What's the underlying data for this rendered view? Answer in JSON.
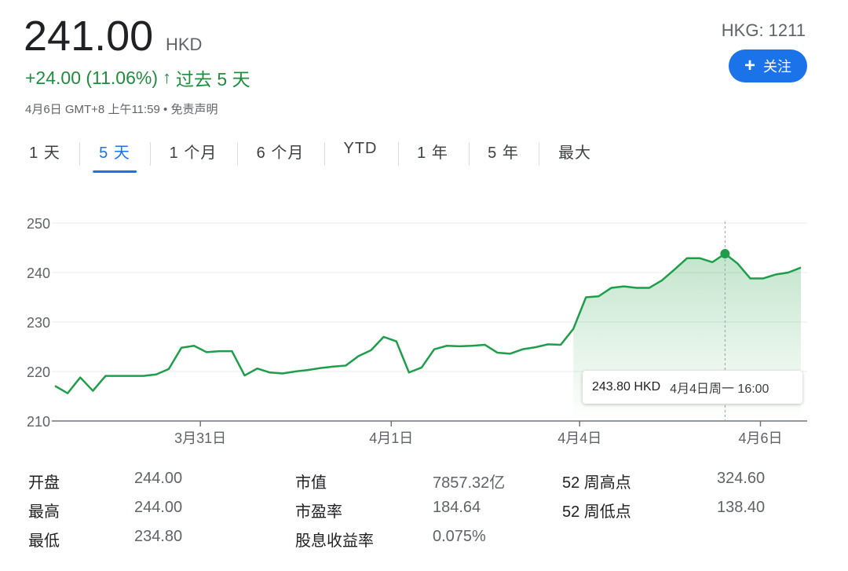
{
  "header": {
    "price": "241.00",
    "currency": "HKD",
    "change": "+24.00 (11.06%)",
    "period": "过去 5 天",
    "timestamp": "4月6日 GMT+8 上午11:59 • 免责声明",
    "ticker": "HKG: 1211",
    "follow_label": "关注"
  },
  "tabs": [
    "1 天",
    "5 天",
    "1 个月",
    "6 个月",
    "YTD",
    "1 年",
    "5 年",
    "最大"
  ],
  "active_tab": "5 天",
  "tooltip": {
    "price": "243.80 HKD",
    "time": "4月4日周一 16:00"
  },
  "stats": {
    "col1": [
      {
        "label": "开盘",
        "value": "244.00"
      },
      {
        "label": "最高",
        "value": "244.00"
      },
      {
        "label": "最低",
        "value": "234.80"
      }
    ],
    "col2": [
      {
        "label": "市值",
        "value": "7857.32亿"
      },
      {
        "label": "市盈率",
        "value": "184.64"
      },
      {
        "label": "股息收益率",
        "value": "0.075%"
      }
    ],
    "col3": [
      {
        "label": "52 周高点",
        "value": "324.60"
      },
      {
        "label": "52 周低点",
        "value": "138.40"
      }
    ]
  },
  "colors": {
    "up": "#1e8e3e",
    "line": "#1e9e4a",
    "accent": "#1a73e8"
  },
  "chart_data": {
    "type": "area",
    "ylim": [
      210,
      250
    ],
    "yticks": [
      210,
      220,
      230,
      240,
      250
    ],
    "xlabels": [
      "3月31日",
      "4月1日",
      "4月4日",
      "4月6日"
    ],
    "xlabel_index": [
      11.5,
      26.6,
      41.5,
      55.8
    ],
    "values": [
      217.1,
      215.6,
      218.8,
      216.1,
      219.1,
      219.1,
      219.1,
      219.1,
      219.4,
      220.5,
      224.8,
      225.2,
      223.9,
      224.1,
      224.1,
      219.2,
      220.6,
      219.8,
      219.6,
      220.0,
      220.3,
      220.7,
      221.0,
      221.2,
      223.1,
      224.3,
      227.0,
      226.1,
      219.8,
      220.8,
      224.5,
      225.2,
      225.1,
      225.2,
      225.4,
      223.8,
      223.6,
      224.5,
      224.9,
      225.5,
      225.4,
      228.6,
      235.0,
      235.2,
      236.9,
      237.2,
      236.9,
      236.9,
      238.4,
      240.6,
      242.9,
      242.9,
      242.1,
      243.8,
      241.8,
      238.8,
      238.8,
      239.6,
      240.0,
      241.0
    ],
    "highlight_index": 53,
    "highlight_value": 243.8
  }
}
